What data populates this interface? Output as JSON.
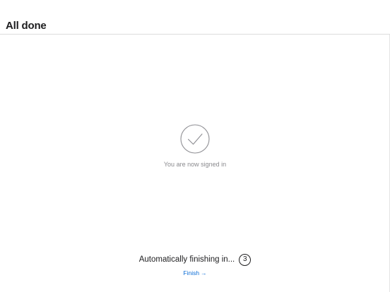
{
  "header": {
    "title": "All done"
  },
  "status": {
    "icon": "checkmark-circle-icon",
    "message": "You are now signed in"
  },
  "countdown": {
    "label": "Automatically finishing in...",
    "seconds": "3",
    "finish_label": "Finish",
    "finish_arrow": "→"
  },
  "colors": {
    "link": "#0a6cd6",
    "text": "#1d1d1f",
    "muted": "#8a8a8e",
    "icon_stroke": "#8e8e93"
  }
}
